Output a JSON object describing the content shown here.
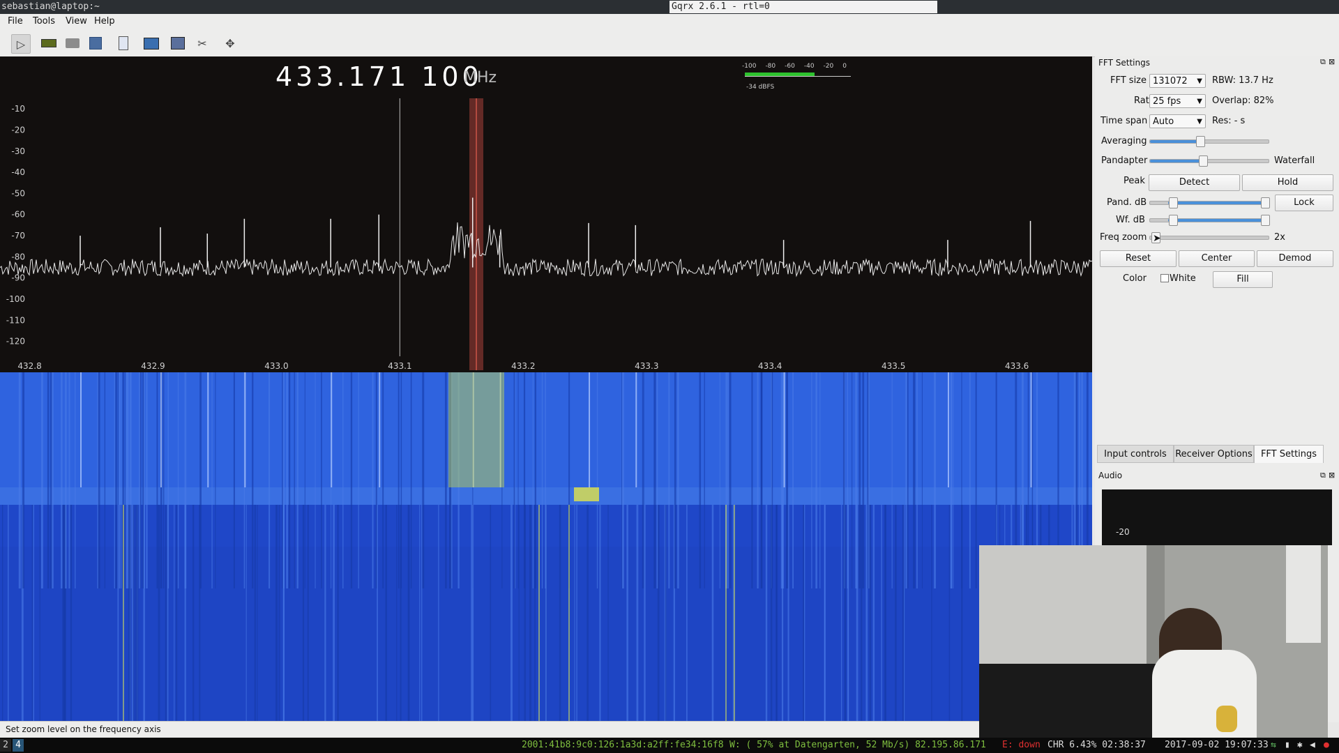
{
  "window": {
    "terminal_title": "sebastian@laptop:~",
    "app_title": "Gqrx 2.6.1 - rtl=0"
  },
  "menu": [
    "File",
    "Tools",
    "View",
    "Help"
  ],
  "toolbar_icons": [
    "play-icon",
    "hardware-icon",
    "open-icon",
    "save-icon",
    "bookmark-icon",
    "dsp-icon",
    "screenshot-icon",
    "tools-icon",
    "fit-icon"
  ],
  "frequency": {
    "value": "433.171 100",
    "unit": "MHz"
  },
  "meter": {
    "scale": [
      "-100",
      "-80",
      "-60",
      "-40",
      "-20",
      "0"
    ],
    "reading": "-34 dBFS",
    "level_fraction": 0.66
  },
  "chart_data": {
    "type": "line",
    "title": "",
    "xlabel": "",
    "ylabel": "",
    "x_ticks": [
      "432.8",
      "432.9",
      "433.0",
      "433.1",
      "433.2",
      "433.3",
      "433.4",
      "433.5",
      "433.6"
    ],
    "y_ticks": [
      "-10",
      "-20",
      "-30",
      "-40",
      "-50",
      "-60",
      "-70",
      "-80",
      "-90",
      "-100",
      "-110",
      "-120"
    ],
    "xlim": [
      432.785,
      433.67
    ],
    "ylim": [
      -125,
      -5
    ],
    "noise_floor": -85,
    "peaks": [
      {
        "x": 432.85,
        "y": -70
      },
      {
        "x": 432.915,
        "y": -66
      },
      {
        "x": 432.953,
        "y": -69
      },
      {
        "x": 432.983,
        "y": -62
      },
      {
        "x": 433.053,
        "y": -62
      },
      {
        "x": 433.092,
        "y": -60
      },
      {
        "x": 433.168,
        "y": -52
      },
      {
        "x": 433.19,
        "y": -70
      },
      {
        "x": 433.262,
        "y": -64
      },
      {
        "x": 433.3,
        "y": -65
      },
      {
        "x": 433.42,
        "y": -72
      },
      {
        "x": 433.553,
        "y": -72
      },
      {
        "x": 433.62,
        "y": -63
      }
    ],
    "marker_x": 433.171,
    "cursor_x": 433.109
  },
  "fft_settings": {
    "title": "FFT Settings",
    "fft_size_label": "FFT size",
    "fft_size": "131072",
    "rbw": "RBW: 13.7 Hz",
    "rate_label": "Rate",
    "rate": "25 fps",
    "overlap": "Overlap: 82%",
    "timespan_label": "Time span",
    "timespan": "Auto",
    "res": "Res: - s",
    "averaging_label": "Averaging",
    "averaging_level": 0.42,
    "pandapter_label": "Pandapter",
    "pandapter_level": 0.44,
    "waterfall_label": "Waterfall",
    "peak_label": "Peak",
    "detect": "Detect",
    "hold": "Hold",
    "pand_db_label": "Pand. dB",
    "lock": "Lock",
    "wf_db_label": "Wf. dB",
    "freq_zoom_label": "Freq zoom",
    "freq_zoom_value": "2x",
    "reset": "Reset",
    "center": "Center",
    "demod": "Demod",
    "color_label": "Color",
    "white_label": "White",
    "fill": "Fill"
  },
  "tabs": [
    "Input controls",
    "Receiver Options",
    "FFT Settings"
  ],
  "audio": {
    "title": "Audio",
    "axis_label": "-20"
  },
  "status_message": "Set zoom level on the frequency axis",
  "i3bar": {
    "workspaces": [
      "2",
      "4"
    ],
    "ipv6": "2001:41b8:9c0:126:1a3d:a2ff:fe34:16f8",
    "wifi": "W: ( 57% at Datengarten, 52 Mb/s) 82.195.86.171",
    "eth": "E: down",
    "battery": "CHR 6.43% 02:38:37",
    "clock": "2017-09-02 19:07:33"
  },
  "colors": {
    "waterfall_blue": "#1f4fd6",
    "spectrum_bg": "#120f0e",
    "marker": "#a8423a"
  }
}
